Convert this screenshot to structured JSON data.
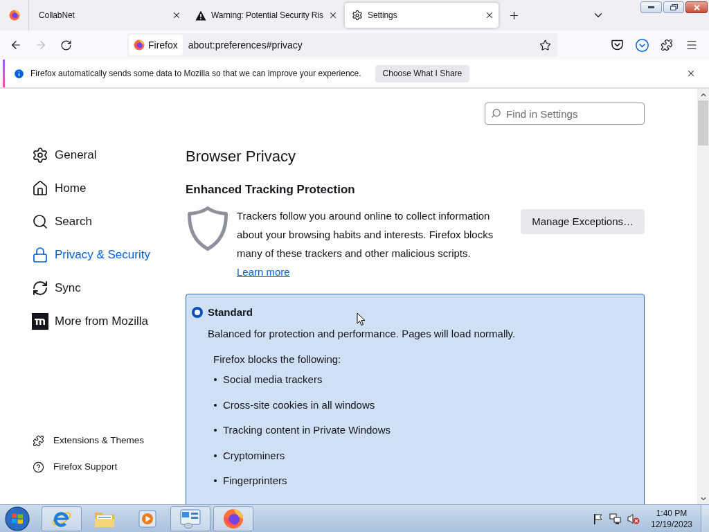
{
  "tabs": [
    {
      "kind": "pinned",
      "selected": false
    },
    {
      "kind": "page",
      "title": "CollabNet",
      "selected": false
    },
    {
      "kind": "page",
      "title": "Warning: Potential Security Ris",
      "selected": false
    },
    {
      "kind": "page",
      "title": "Settings",
      "selected": true
    }
  ],
  "nav_buttons": [
    {
      "kind": "back",
      "disabled": false
    },
    {
      "kind": "forward",
      "disabled": true
    },
    {
      "kind": "reload",
      "disabled": false
    }
  ],
  "address_bar": {
    "identity": "Firefox",
    "url": "about:preferences#privacy"
  },
  "notification": {
    "text": "Firefox automatically sends some data to Mozilla so that we can improve your experience.",
    "button": "Choose What I Share"
  },
  "search": {
    "placeholder": "Find in Settings"
  },
  "sidebar": {
    "items": [
      {
        "label": "General",
        "selected": false
      },
      {
        "label": "Home",
        "selected": false
      },
      {
        "label": "Search",
        "selected": false
      },
      {
        "label": "Privacy & Security",
        "selected": true
      },
      {
        "label": "Sync",
        "selected": false
      },
      {
        "label": "More from Mozilla",
        "selected": false
      }
    ],
    "footer": [
      {
        "label": "Extensions & Themes"
      },
      {
        "label": "Firefox Support"
      }
    ]
  },
  "privacy": {
    "heading": "Browser Privacy",
    "section_title": "Enhanced Tracking Protection",
    "description": "Trackers follow you around online to collect information about your browsing habits and interests. Firefox blocks many of these trackers and other malicious scripts.",
    "link": "Learn more",
    "button": "Manage Exceptions…",
    "options": [
      {
        "label": "Standard",
        "selected": true,
        "description": "Balanced for protection and performance. Pages will load normally.",
        "blocks_heading": "Firefox blocks the following:",
        "blocks": [
          "Social media trackers",
          "Cross-site cookies in all windows",
          "Tracking content in Private Windows",
          "Cryptominers",
          "Fingerprinters"
        ]
      }
    ]
  },
  "taskbar": {
    "apps": [
      {
        "running": true
      },
      {
        "running": false
      },
      {
        "running": false
      },
      {
        "running": true
      },
      {
        "running": true
      }
    ],
    "clock": {
      "time": "1:40 PM",
      "date": "12/19/2023"
    }
  }
}
